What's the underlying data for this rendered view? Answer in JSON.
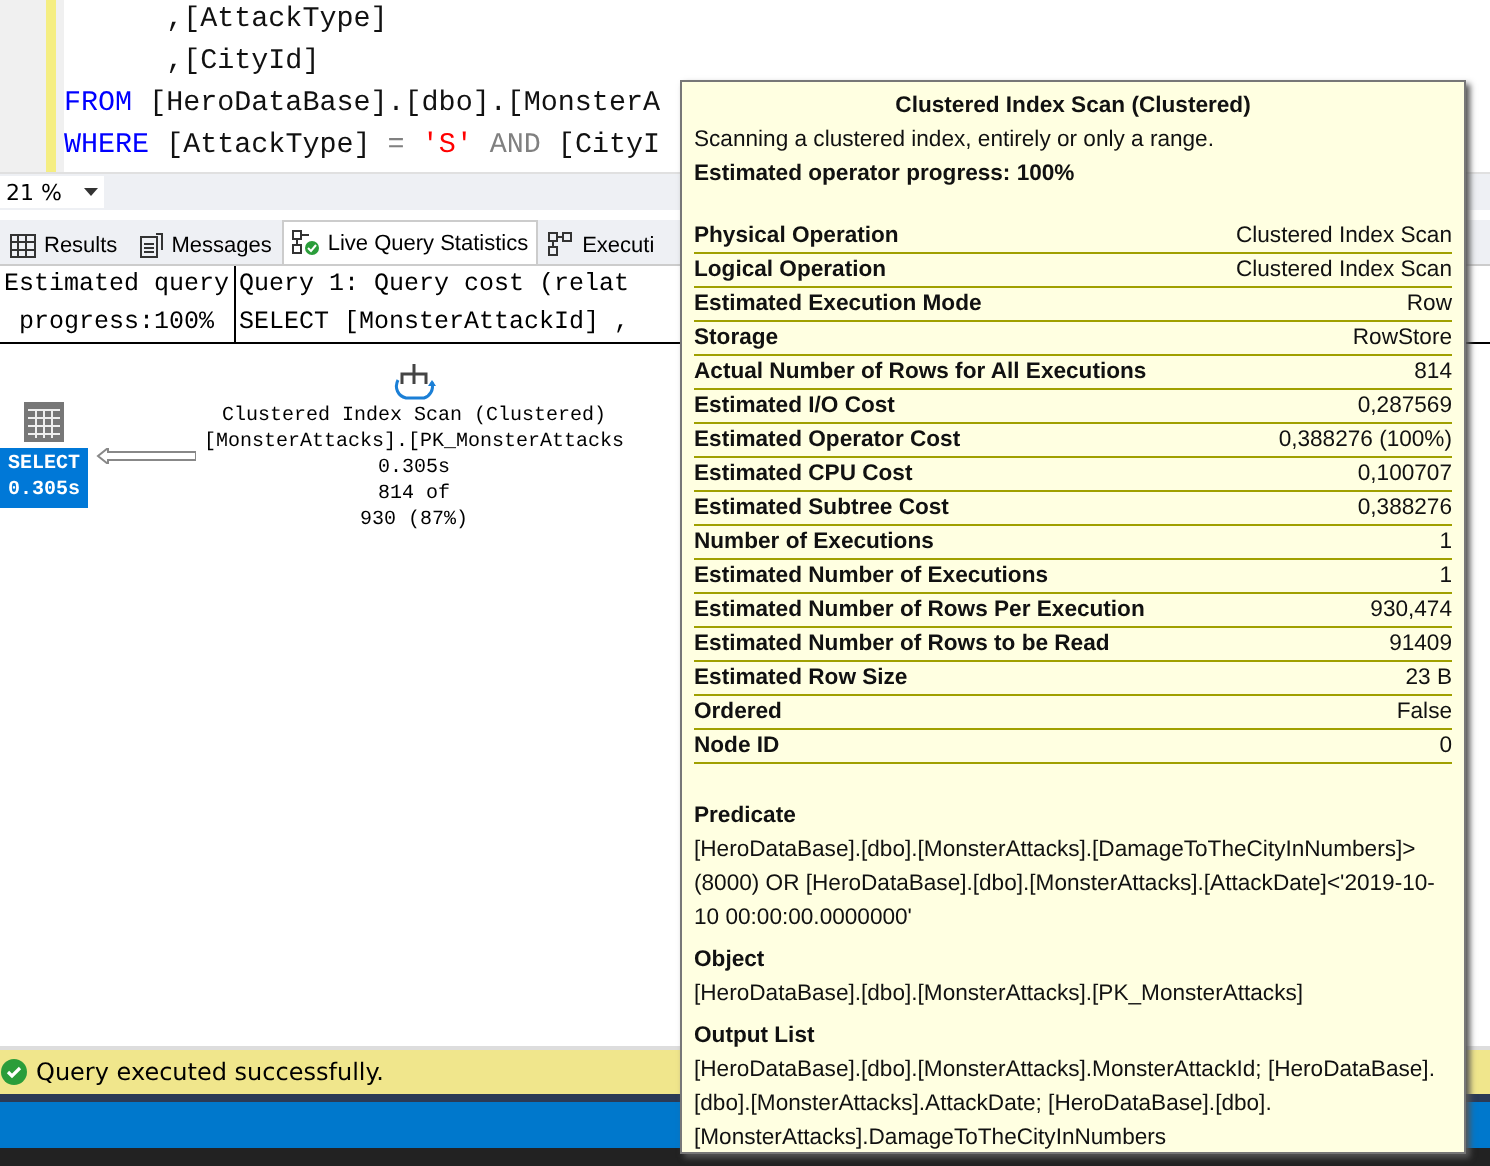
{
  "editor": {
    "lines": [
      {
        "tokens": [
          {
            "kind": "plain",
            "text": "      ,[AttackType]"
          }
        ]
      },
      {
        "tokens": [
          {
            "kind": "plain",
            "text": "      ,[CityId]"
          }
        ]
      },
      {
        "tokens": [
          {
            "kind": "keyword",
            "text": "FROM"
          },
          {
            "kind": "plain",
            "text": " [HeroDataBase].[dbo].[MonsterA"
          }
        ]
      },
      {
        "tokens": [
          {
            "kind": "keyword",
            "text": "WHERE"
          },
          {
            "kind": "plain",
            "text": " [AttackType] "
          },
          {
            "kind": "operator",
            "text": "= "
          },
          {
            "kind": "string",
            "text": "'S'"
          },
          {
            "kind": "operator",
            "text": " AND"
          },
          {
            "kind": "plain",
            "text": " [CityI"
          }
        ]
      }
    ]
  },
  "zoom": {
    "value": "21 %"
  },
  "tabs": [
    {
      "label": "Results",
      "selected": false
    },
    {
      "label": "Messages",
      "selected": false
    },
    {
      "label": "Live Query Statistics",
      "selected": true
    },
    {
      "label": "Executi",
      "selected": false
    }
  ],
  "progress": {
    "line_1": "Estimated query",
    "line_2": "progress:100%"
  },
  "query": {
    "line_1": "Query 1: Query cost (relat",
    "line_2": "SELECT [MonsterAttackId] ,"
  },
  "plan": {
    "select_node": {
      "label": "SELECT",
      "time": "0.305s",
      "selected": true
    },
    "scan_node": {
      "lines": [
        "Clustered Index Scan (Clustered)",
        "[MonsterAttacks].[PK_MonsterAttacks",
        "0.305s",
        "814 of",
        "930 (87%)"
      ]
    }
  },
  "status": {
    "message": "Query executed successfully."
  },
  "tooltip": {
    "title": "Clustered Index Scan (Clustered)",
    "description": "Scanning a clustered index, entirely or only a range.",
    "progress": "Estimated operator progress: 100%",
    "properties": [
      {
        "name": "Physical Operation",
        "value": "Clustered Index Scan"
      },
      {
        "name": "Logical Operation",
        "value": "Clustered Index Scan"
      },
      {
        "name": "Estimated Execution Mode",
        "value": "Row"
      },
      {
        "name": "Storage",
        "value": "RowStore"
      },
      {
        "name": "Actual Number of Rows for All Executions",
        "value": "814"
      },
      {
        "name": "Estimated I/O Cost",
        "value": "0,287569"
      },
      {
        "name": "Estimated Operator Cost",
        "value": "0,388276 (100%)"
      },
      {
        "name": "Estimated CPU Cost",
        "value": "0,100707"
      },
      {
        "name": "Estimated Subtree Cost",
        "value": "0,388276"
      },
      {
        "name": "Number of Executions",
        "value": "1"
      },
      {
        "name": "Estimated Number of Executions",
        "value": "1"
      },
      {
        "name": "Estimated Number of Rows Per Execution",
        "value": "930,474"
      },
      {
        "name": "Estimated Number of Rows to be Read",
        "value": "91409"
      },
      {
        "name": "Estimated Row Size",
        "value": "23 B"
      },
      {
        "name": "Ordered",
        "value": "False"
      },
      {
        "name": "Node ID",
        "value": "0"
      }
    ],
    "sections": [
      {
        "heading": "Predicate",
        "text": "[HeroDataBase].[dbo].[MonsterAttacks].[DamageToTheCityInNumbers]>(8000) OR [HeroDataBase].[dbo].[MonsterAttacks].[AttackDate]<'2019-10-10 00:00:00.0000000'"
      },
      {
        "heading": "Object",
        "text": "[HeroDataBase].[dbo].[MonsterAttacks].[PK_MonsterAttacks]"
      },
      {
        "heading": "Output List",
        "text": "[HeroDataBase].[dbo].[MonsterAttacks].MonsterAttackId; [HeroDataBase].[dbo].[MonsterAttacks].AttackDate; [HeroDataBase].[dbo].[MonsterAttacks].DamageToTheCityInNumbers"
      }
    ]
  }
}
